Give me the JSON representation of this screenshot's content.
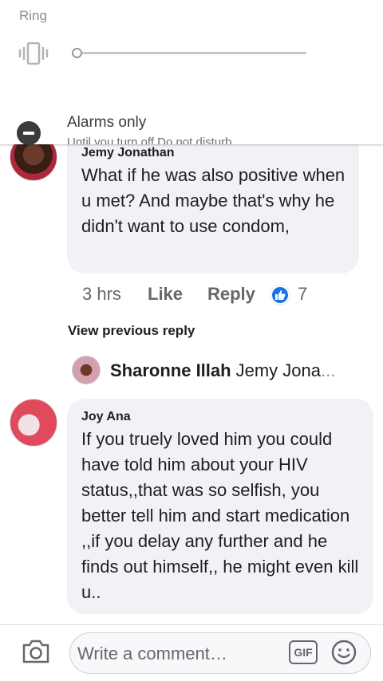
{
  "volume_panel": {
    "ring_label": "Ring",
    "alarms_label": "Alarms only",
    "until_label": "Until you turn off Do not disturb"
  },
  "comments": [
    {
      "author": "Jemy Jonathan",
      "text": "What if he was also positive when u met? And maybe that's why he didn't want to use condom,",
      "time": "3 hrs",
      "like_label": "Like",
      "reply_label": "Reply",
      "reaction_count": "7"
    },
    {
      "author": "Joy Ana",
      "text": "If you truely loved him you could have told him about your HIV status,,that was so selfish, you better tell him and start medication ,,if you delay any further and he finds out himself,, he might even kill u.."
    }
  ],
  "view_previous_reply": "View previous reply",
  "reply_preview": {
    "author": "Sharonne Illah",
    "text": "Jemy Jona",
    "ellipsis": "..."
  },
  "composer": {
    "placeholder": "Write a comment…",
    "gif_label": "GIF"
  },
  "colors": {
    "accent": "#1b74e4",
    "bubble": "#f0f2f5",
    "meta_text": "#65676b"
  }
}
